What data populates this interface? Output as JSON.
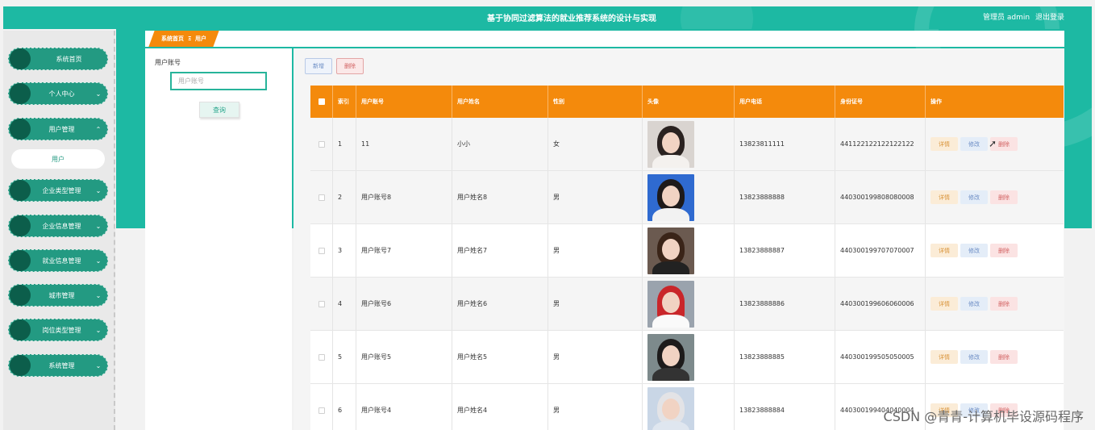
{
  "header": {
    "title": "基于协同过滤算法的就业推荐系统的设计与实现",
    "user_label": "管理员 admin",
    "logout": "退出登录"
  },
  "sidebar": {
    "items": [
      {
        "label": "系统首页",
        "icon": "circle-icon",
        "expandable": false
      },
      {
        "label": "个人中心",
        "icon": "circle-icon",
        "expandable": true,
        "chevron": "⌄"
      },
      {
        "label": "用户管理",
        "icon": "circle-icon",
        "expandable": true,
        "chevron": "⌃"
      },
      {
        "label": "企业类型管理",
        "icon": "circle-icon",
        "expandable": true,
        "chevron": "⌄"
      },
      {
        "label": "企业信息管理",
        "icon": "circle-icon",
        "expandable": true,
        "chevron": "⌄"
      },
      {
        "label": "就业信息管理",
        "icon": "circle-icon",
        "expandable": true,
        "chevron": "⌄"
      },
      {
        "label": "城市管理",
        "icon": "circle-icon",
        "expandable": true,
        "chevron": "⌄"
      },
      {
        "label": "岗位类型管理",
        "icon": "circle-icon",
        "expandable": true,
        "chevron": "⌄"
      },
      {
        "label": "系统管理",
        "icon": "circle-icon",
        "expandable": true,
        "chevron": "⌄"
      }
    ],
    "submenu": {
      "label": "用户"
    }
  },
  "breadcrumb": {
    "home": "系统首页",
    "separator": "Ξ",
    "current": "用户"
  },
  "search": {
    "label": "用户账号",
    "placeholder": "用户账号",
    "button": "查询"
  },
  "toolbar": {
    "add": "新增",
    "delete": "删除"
  },
  "table": {
    "headers": [
      "索引",
      "用户账号",
      "用户姓名",
      "性别",
      "头像",
      "用户电话",
      "身份证号",
      "操作"
    ],
    "rows": [
      {
        "index": "1",
        "account": "11",
        "name": "小小",
        "gender": "女",
        "phone": "13823811111",
        "id_no": "441122122122122122"
      },
      {
        "index": "2",
        "account": "用户账号8",
        "name": "用户姓名8",
        "gender": "男",
        "phone": "13823888888",
        "id_no": "440300199808080008"
      },
      {
        "index": "3",
        "account": "用户账号7",
        "name": "用户姓名7",
        "gender": "男",
        "phone": "13823888887",
        "id_no": "440300199707070007"
      },
      {
        "index": "4",
        "account": "用户账号6",
        "name": "用户姓名6",
        "gender": "男",
        "phone": "13823888886",
        "id_no": "440300199606060006"
      },
      {
        "index": "5",
        "account": "用户账号5",
        "name": "用户姓名5",
        "gender": "男",
        "phone": "13823888885",
        "id_no": "440300199505050005"
      },
      {
        "index": "6",
        "account": "用户账号4",
        "name": "用户姓名4",
        "gender": "男",
        "phone": "13823888884",
        "id_no": "440300199404040004"
      }
    ],
    "ops": {
      "detail": "详情",
      "edit": "修改",
      "delete": "删除"
    }
  },
  "watermark": "CSDN @青青-计算机毕设源码程序",
  "colors": {
    "primary": "#1db9a3",
    "menu": "#239a82",
    "menu_dot": "#0c5e4b",
    "table_head": "#f48a0c"
  }
}
